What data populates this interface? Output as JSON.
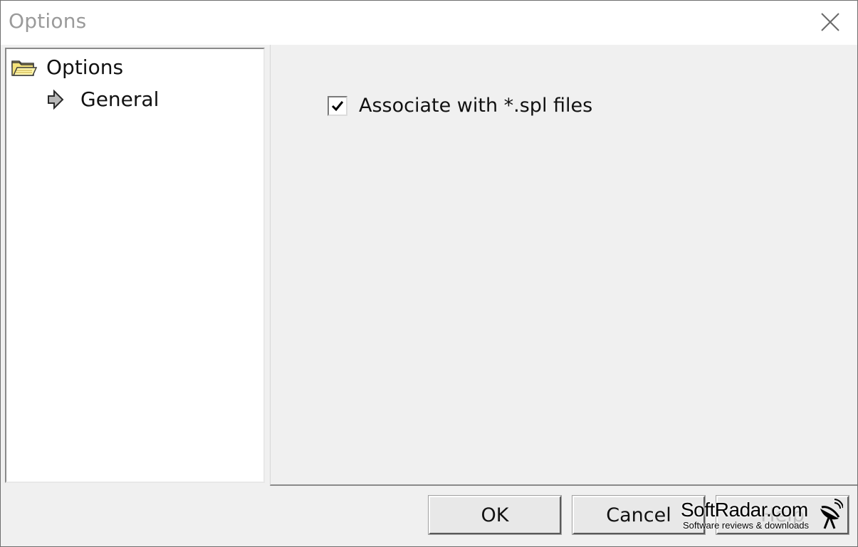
{
  "window": {
    "title": "Options"
  },
  "tree": {
    "root_label": "Options",
    "child_label": "General",
    "root_icon": "folder-open-icon",
    "child_icon": "arrow-right-icon"
  },
  "settings": {
    "associate_checkbox": {
      "label": "Associate with *.spl files",
      "checked": true
    }
  },
  "buttons": {
    "ok": "OK",
    "cancel": "Cancel",
    "help": "Help"
  },
  "watermark": {
    "title": "SoftRadar.com",
    "subtitle": "Software reviews & downloads"
  }
}
